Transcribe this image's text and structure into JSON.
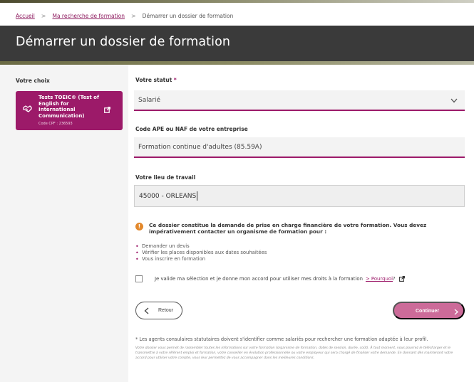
{
  "breadcrumb": {
    "home": "Accueil",
    "search": "Ma recherche de formation",
    "current": "Démarrer un dossier de formation",
    "separator": ">"
  },
  "page": {
    "title": "Démarrer un dossier de formation"
  },
  "sidebar": {
    "choice_title": "Votre choix",
    "card": {
      "title": "Tests TOEIC® (Test of English for International Communication)",
      "code": "Code CPF : 236593",
      "icon": "handshake-icon",
      "external_icon": "external-link-icon"
    }
  },
  "form": {
    "status": {
      "label": "Votre statut",
      "required_mark": "*",
      "value": "Salarié"
    },
    "ape": {
      "label": "Code APE ou NAF de votre entreprise",
      "value": "Formation continue d'adultes (85.59A)"
    },
    "workplace": {
      "label": "Votre lieu de travail",
      "value": "45000 - ORLEANS"
    }
  },
  "notice": {
    "icon": "info-icon",
    "icon_glyph": "!",
    "text": "Ce dossier constitue la demande de prise en charge financière de votre formation. Vous devez impérativement contacter un organisme de formation pour :",
    "items": [
      "Demander un devis",
      "Vérifier les places disponibles aux dates souhaitées",
      "Vous inscrire en formation"
    ]
  },
  "consent": {
    "text": "Je valide ma sélection et je donne mon accord pour utiliser mes droits à la formation",
    "why": "> Pourquoi",
    "question_mark": "?"
  },
  "actions": {
    "back": "Retour",
    "next": "Continuer"
  },
  "footer": {
    "note": "* Les agents consulaires statutaires doivent s'identifier comme salariés pour rechercher une formation adaptée à leur profil.",
    "fineprint": "Votre dossier vous permet de rassembler toutes les informations sur votre formation (organisme de formation, dates de session, durée, coût). À tout moment, vous pourrez le télécharger et le transmettre à votre référent emploi et formation, votre conseiller en évolution professionnelle ou votre employeur qui sera chargé de finaliser votre demande. En donnant dès maintenant votre accord pour utiliser votre compte, vous leur permettez de vous accompagner dans les meilleures conditions."
  },
  "colors": {
    "brand": "#9c1a69",
    "header_bg": "#3a3a3a",
    "button_next": "#cc6b99",
    "notice_icon": "#e3882b"
  }
}
